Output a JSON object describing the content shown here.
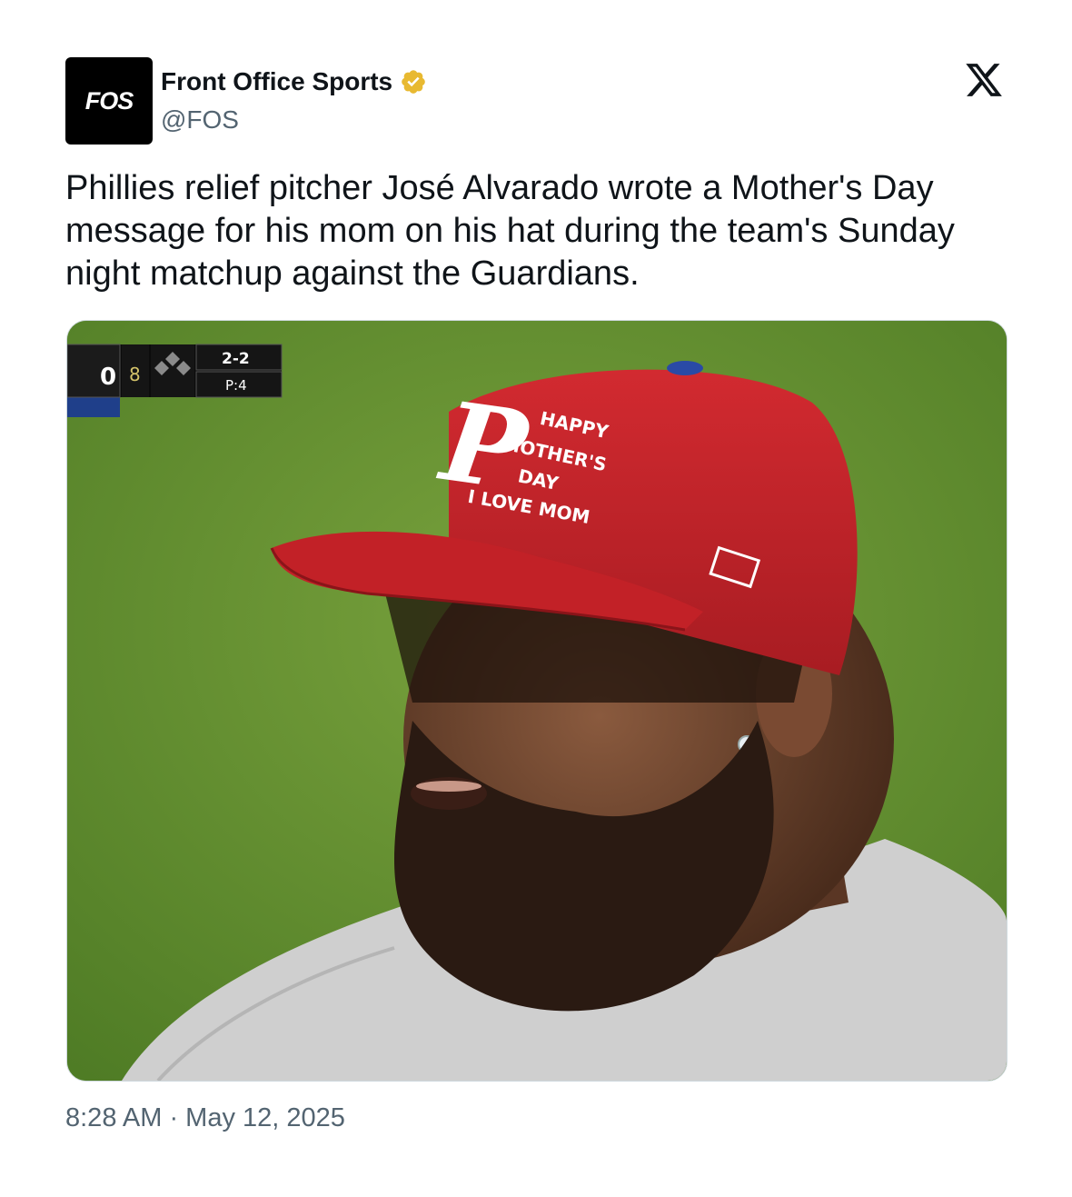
{
  "author": {
    "avatar_text": "FOS",
    "display_name": "Front Office Sports",
    "handle": "@FOS",
    "verified": true,
    "verified_color": "#e8b931"
  },
  "tweet": {
    "text": "Phillies relief pitcher José Alvarado wrote a Mother's Day message for his mom on his hat during the team's Sunday night matchup against the Guardians.",
    "timestamp": "8:28 AM · May 12, 2025"
  },
  "media": {
    "scorebug": {
      "score": "0",
      "inning": "8",
      "count": "2-2",
      "pitches": "P:4"
    },
    "hat_message": [
      "HAPPY",
      "MOTHER'S",
      "DAY",
      "I LOVE MOM"
    ],
    "hat_letter": "P",
    "colors": {
      "grass": "#5f8a2e",
      "cap_red": "#c8232c",
      "jersey": "#cfcfcf"
    }
  },
  "icons": {
    "x_logo": "x-logo-icon",
    "verified": "verified-badge-icon"
  }
}
